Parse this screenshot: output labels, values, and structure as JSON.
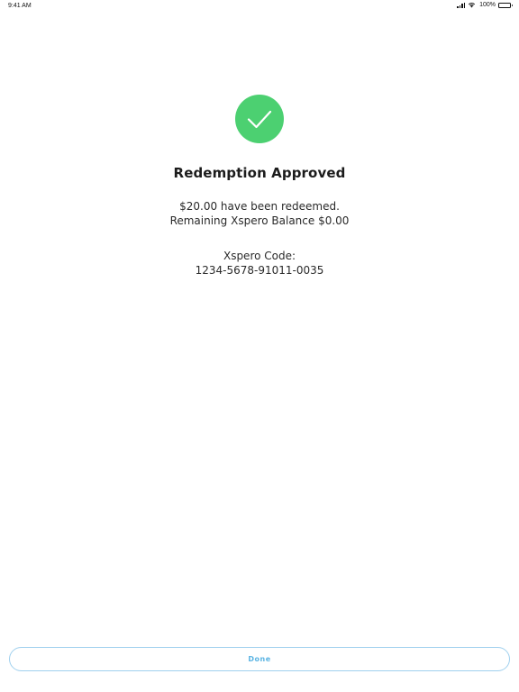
{
  "status_bar": {
    "time": "9:41 AM",
    "battery": "100%"
  },
  "success": {
    "icon": "checkmark-icon",
    "icon_color": "#4cd071",
    "title": "Redemption Approved",
    "message_line1": "$20.00 have been redeemed.",
    "message_line2": "Remaining Xspero Balance $0.00",
    "code_label": "Xspero Code:",
    "code_value": "1234-5678-91011-0035"
  },
  "footer": {
    "done_label": "Done",
    "accent_color": "#5bb4e3"
  }
}
